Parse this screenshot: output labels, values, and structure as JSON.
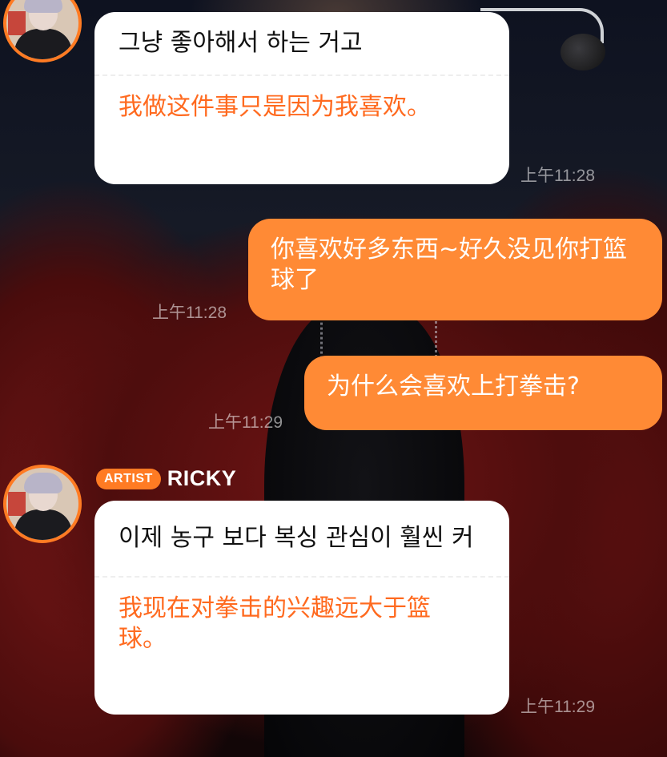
{
  "messages": [
    {
      "side": "in",
      "korean": "그냥 좋아해서 하는 거고",
      "chinese": "我做这件事只是因为我喜欢。",
      "time": "上午11:28"
    },
    {
      "side": "out",
      "text": "你喜欢好多东西~好久没见你打篮球了",
      "time": "上午11:28"
    },
    {
      "side": "out",
      "text": "为什么会喜欢上打拳击?",
      "time": "上午11:29"
    },
    {
      "side": "in",
      "badge": "ARTIST",
      "sender": "RICKY",
      "korean": "이제 농구 보다 복싱 관심이 훨씬 커",
      "chinese": "我现在对拳击的兴趣远大于篮球。",
      "time": "上午11:29"
    }
  ],
  "colors": {
    "accent": "#ff7b23",
    "outgoing_bubble": "#ff8a35",
    "incoming_bubble": "#ffffff",
    "translation_text": "#ff6a1f"
  }
}
